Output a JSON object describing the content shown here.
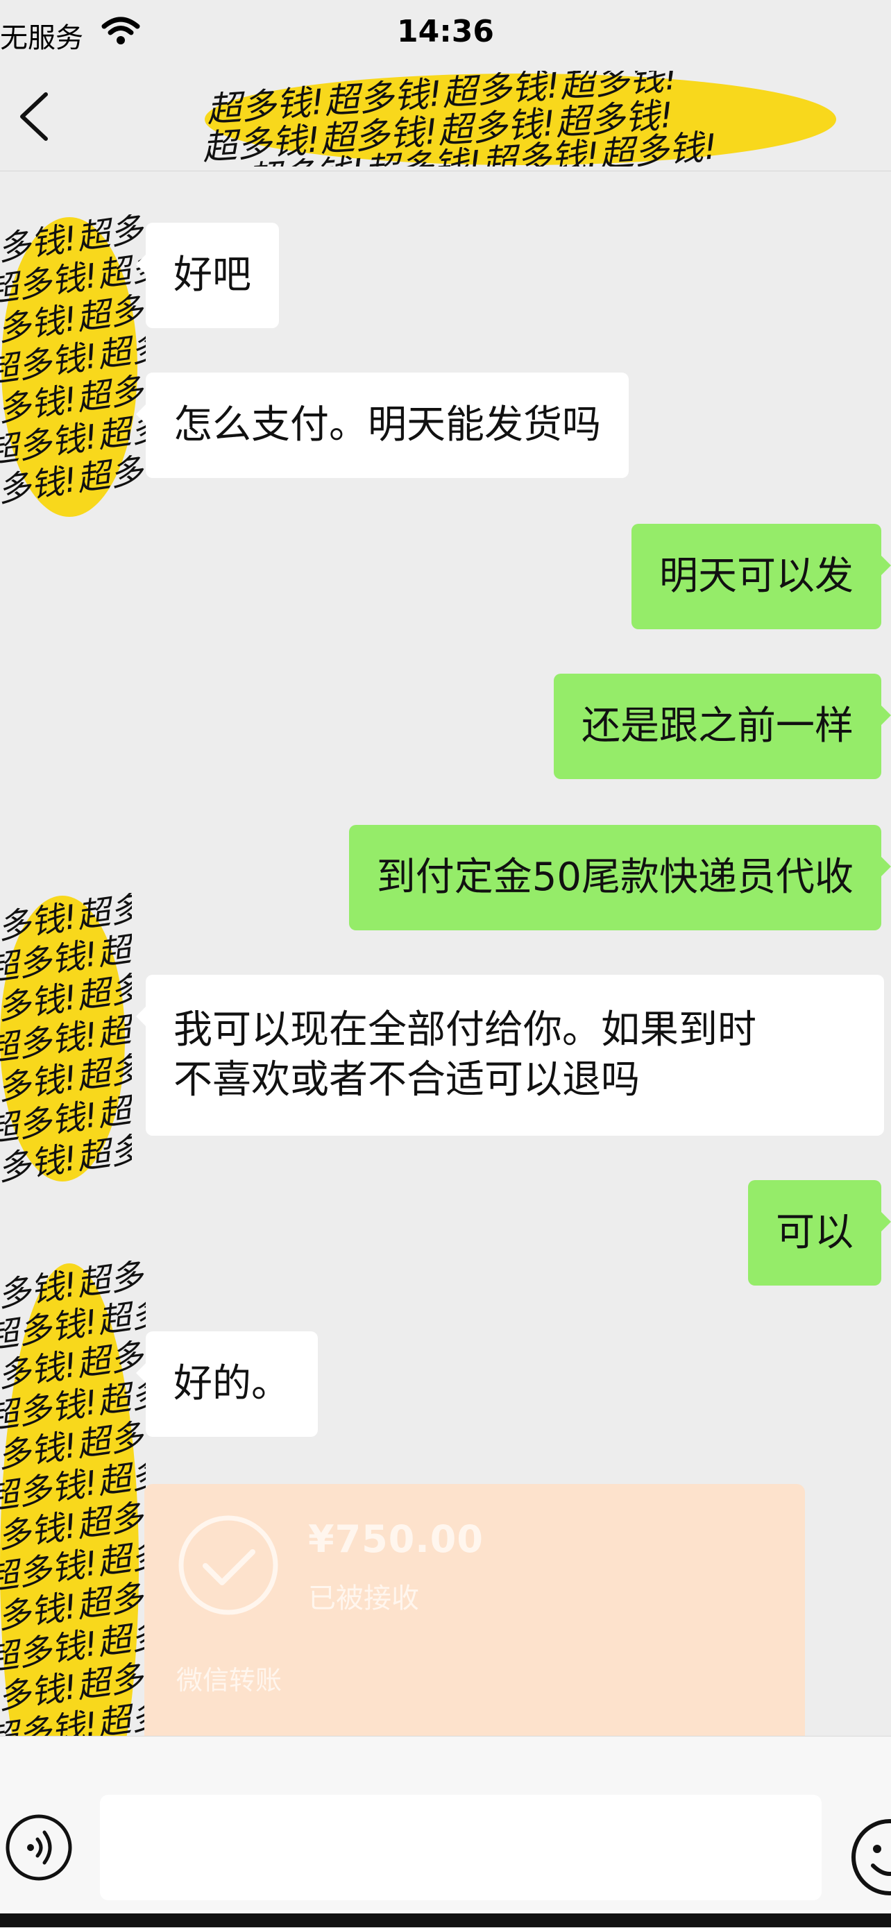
{
  "status_bar": {
    "carrier": "无服务",
    "time": "14:36"
  },
  "nav": {
    "back_icon": "chevron-left-icon",
    "title_redaction_text": "超多钱!超多钱!超多钱!超多钱!"
  },
  "messages": [
    {
      "side": "in",
      "text": "好吧"
    },
    {
      "side": "in",
      "text": "怎么支付。明天能发货吗"
    },
    {
      "side": "out",
      "text": "明天可以发"
    },
    {
      "side": "out",
      "text": "还是跟之前一样"
    },
    {
      "side": "out",
      "text": "到付定金50尾款快递员代收"
    },
    {
      "side": "in",
      "text": "我可以现在全部付给你。如果到时\n不喜欢或者不合适可以退吗"
    },
    {
      "side": "out",
      "text": "可以"
    },
    {
      "side": "in",
      "text": "好的。"
    }
  ],
  "avatar_redaction_text": "超多钱!",
  "transfer": {
    "amount": "¥750.00",
    "status": "已被接收",
    "label": "微信转账",
    "icon": "check-circle-icon"
  },
  "input_bar": {
    "voice_icon": "voice-icon",
    "emoji_icon": "emoji-icon",
    "input_value": ""
  },
  "colors": {
    "background": "#ededed",
    "outgoing_bubble": "#95ec69",
    "incoming_bubble": "#ffffff",
    "transfer_card": "#fde2cc",
    "redaction_yellow": "#f8d81c"
  }
}
